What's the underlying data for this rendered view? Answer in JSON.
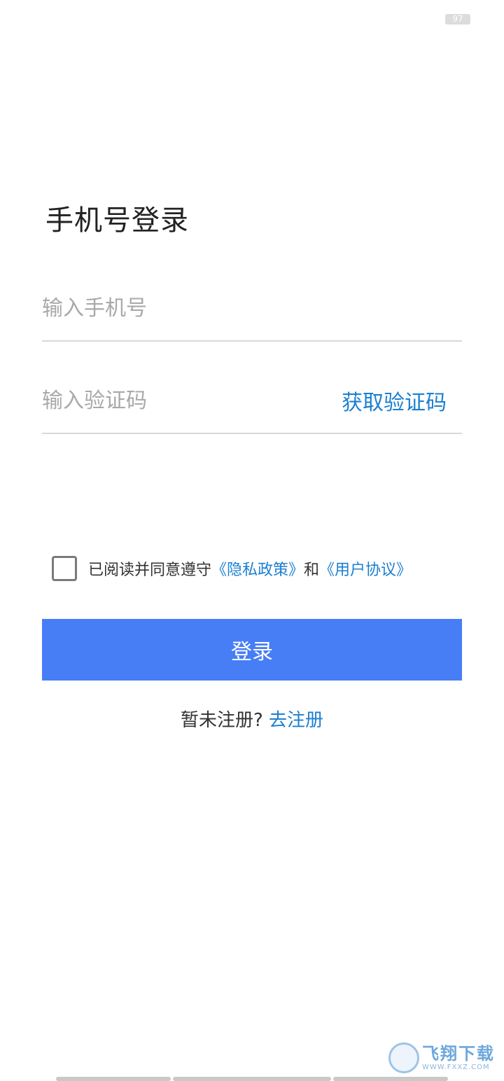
{
  "status_bar": {
    "battery": "97"
  },
  "page_title": "手机号登录",
  "phone_field": {
    "placeholder": "输入手机号",
    "value": ""
  },
  "code_field": {
    "placeholder": "输入验证码",
    "value": "",
    "get_code_label": "获取验证码"
  },
  "agreement": {
    "checked": false,
    "prefix": "已阅读并同意遵守",
    "privacy_link": "《隐私政策》",
    "conjunction": "和",
    "terms_link": "《用户协议》"
  },
  "login_button": "登录",
  "register": {
    "prompt": "暂未注册?",
    "link": "去注册"
  },
  "watermark": {
    "main": "飞翔下载",
    "sub": "WWW.FXXZ.COM"
  },
  "colors": {
    "primary_button": "#477ef6",
    "link": "#1c7fd0"
  }
}
